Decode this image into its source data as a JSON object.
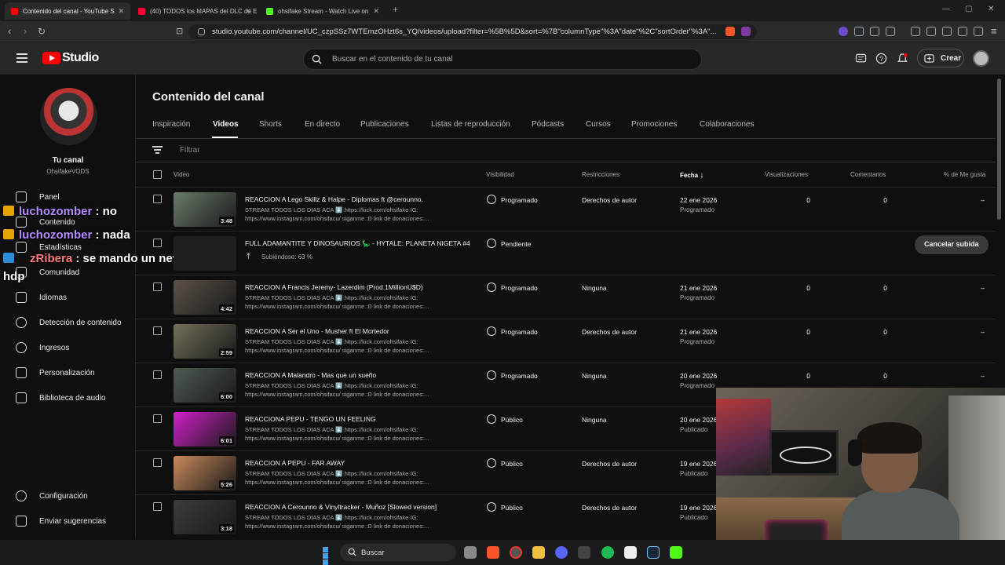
{
  "browser": {
    "tabs": [
      {
        "title": "Contenido del canal - YouTube S",
        "active": true,
        "color": "#ff0000"
      },
      {
        "title": "(40) TODOS los MAPAS del DLC de E",
        "active": false,
        "color": "#ff0033"
      },
      {
        "title": "ohsifake Stream - Watch Live on",
        "active": false,
        "color": "#53fc18"
      }
    ],
    "new_tab": "+",
    "url": "studio.youtube.com/channel/UC_czpSSz7WTEmzOHzt6s_YQ/videos/upload?filter=%5B%5D&sort=%7B\"columnType\"%3A\"date\"%2C\"sortOrder\"%3A\"..."
  },
  "studio": {
    "logo_text": "Studio",
    "search_placeholder": "Buscar en el contenido de tu canal",
    "create_label": "Crear"
  },
  "channel": {
    "title": "Tu canal",
    "handle": "OhsifakeVODS"
  },
  "sidebar": {
    "items": [
      {
        "label": "Panel",
        "icon": "dashboard-icon"
      },
      {
        "label": "Contenido",
        "icon": "content-icon"
      },
      {
        "label": "Estadísticas",
        "icon": "analytics-icon"
      },
      {
        "label": "Comunidad",
        "icon": "community-icon"
      },
      {
        "label": "Idiomas",
        "icon": "languages-icon"
      },
      {
        "label": "Detección de contenido",
        "icon": "content-detection-icon"
      },
      {
        "label": "Ingresos",
        "icon": "earn-icon"
      },
      {
        "label": "Personalización",
        "icon": "customization-icon"
      },
      {
        "label": "Biblioteca de audio",
        "icon": "audio-library-icon"
      }
    ],
    "bottom_items": [
      {
        "label": "Configuración",
        "icon": "settings-icon"
      },
      {
        "label": "Enviar sugerencias",
        "icon": "feedback-icon"
      }
    ]
  },
  "chat_overlay": [
    {
      "user": "luchozomber",
      "message": ": no"
    },
    {
      "user": "luchozomber",
      "message": ": nada"
    },
    {
      "user": "zRibera",
      "message": ": se mando un nevadito el",
      "continuation": "hdp"
    }
  ],
  "main": {
    "title": "Contenido del canal",
    "tabs": [
      "Inspiración",
      "Videos",
      "Shorts",
      "En directo",
      "Publicaciones",
      "Listas de reproducción",
      "Pódcasts",
      "Cursos",
      "Promociones",
      "Colaboraciones"
    ],
    "active_tab": "Videos",
    "filter_label": "Filtrar",
    "columns": {
      "video": "Video",
      "visibility": "Visibilidad",
      "restrictions": "Restricciones",
      "date": "Fecha",
      "views": "Visualizaciones",
      "comments": "Comentarios",
      "likes": "% de Me gusta"
    },
    "cancel_upload": "Cancelar subida",
    "rows": [
      {
        "title": "REACCION A Lego Skillz & Halpe - Diplomas ft @cerounno.",
        "desc1": "STREAM TODOS LOS DIAS ACA ⬇️ https://kick.com/ohsifake IG:",
        "desc2": "https://www.instagram.com/ohsifacu/ siganme :D link de donaciones:...",
        "duration": "3:48",
        "visibility": "Programado",
        "visibility_icon": "clock-icon",
        "restrictions": "Derechos de autor",
        "date": "22 ene 2026",
        "status": "Programado",
        "views": "0",
        "comments": "0",
        "likes": "–",
        "thumb_color": "#6a7b6a"
      },
      {
        "title": "FULL ADAMANTITE Y DINOSAURIOS 🦕 - HYTALE: PLANETA NIGETA #4",
        "progress": "Subiéndose: 63 %",
        "visibility": "Pendiente",
        "visibility_icon": "clock-icon",
        "uploading": true
      },
      {
        "title": "REACCION A Francis Jeremy- Lazerdim (Prod.1MillionU$D)",
        "desc1": "STREAM TODOS LOS DIAS ACA ⬇️ https://kick.com/ohsifake IG:",
        "desc2": "https://www.instagram.com/ohsifacu/ siganme :D link de donaciones:...",
        "duration": "4:42",
        "visibility": "Programado",
        "visibility_icon": "clock-icon",
        "restrictions": "Ninguna",
        "date": "21 ene 2026",
        "status": "Programado",
        "views": "0",
        "comments": "0",
        "likes": "–",
        "thumb_color": "#5b5148"
      },
      {
        "title": "REACCION A Ser el Uno - Musher ft El Mortedor",
        "desc1": "STREAM TODOS LOS DIAS ACA ⬇️ https://kick.com/ohsifake IG:",
        "desc2": "https://www.instagram.com/ohsifacu/ siganme :D link de donaciones:...",
        "duration": "2:59",
        "visibility": "Programado",
        "visibility_icon": "clock-icon",
        "restrictions": "Derechos de autor",
        "date": "21 ene 2026",
        "status": "Programado",
        "views": "0",
        "comments": "0",
        "likes": "–",
        "thumb_color": "#74705a"
      },
      {
        "title": "REACCION A Malandro - Mas que un sueño",
        "desc1": "STREAM TODOS LOS DIAS ACA ⬇️ https://kick.com/ohsifake IG:",
        "desc2": "https://www.instagram.com/ohsifacu/ siganme :D link de donaciones:...",
        "duration": "6:00",
        "visibility": "Programado",
        "visibility_icon": "clock-icon",
        "restrictions": "Ninguna",
        "date": "20 ene 2026",
        "status": "Programado",
        "views": "0",
        "comments": "0",
        "likes": "–",
        "thumb_color": "#4f5a52"
      },
      {
        "title": "REACCIONA PEPU - TENGO UN FEELING",
        "desc1": "STREAM TODOS LOS DIAS ACA ⬇️ https://kick.com/ohsifake IG:",
        "desc2": "https://www.instagram.com/ohsifacu/ siganme :D link de donaciones:...",
        "duration": "6:01",
        "visibility": "Público",
        "visibility_icon": "globe-icon",
        "restrictions": "Ninguna",
        "date": "20 ene 2026",
        "status": "Publicado",
        "views": "",
        "comments": "",
        "likes": "",
        "thumb_color": "#d020c8"
      },
      {
        "title": "REACCION A PEPU - FAR AWAY",
        "desc1": "STREAM TODOS LOS DIAS ACA ⬇️ https://kick.com/ohsifake IG:",
        "desc2": "https://www.instagram.com/ohsifacu/ siganme :D link de donaciones:...",
        "duration": "5:26",
        "visibility": "Público",
        "visibility_icon": "globe-icon",
        "restrictions": "Derechos de autor",
        "date": "19 ene 2026",
        "status": "Publicado",
        "views": "",
        "comments": "",
        "likes": "",
        "thumb_color": "#c98a5a"
      },
      {
        "title": "REACCION A Cerounno & Vinyltracker - Muñoz [Slowed version]",
        "desc1": "STREAM TODOS LOS DIAS ACA ⬇️ https://kick.com/ohsifake IG:",
        "desc2": "https://www.instagram.com/ohsifacu/ siganme :D link de donaciones:...",
        "duration": "3:18",
        "visibility": "Público",
        "visibility_icon": "globe-icon",
        "restrictions": "Derechos de autor",
        "date": "19 ene 2026",
        "status": "Publicado",
        "views": "",
        "comments": "",
        "likes": "",
        "thumb_color": "#3b3b3b"
      }
    ]
  },
  "taskbar": {
    "search_label": "Buscar",
    "apps": [
      "file-explorer-icon",
      "brave-icon",
      "chrome-icon",
      "folder-icon",
      "discord-icon",
      "pen-icon",
      "spotify-icon",
      "capcut-icon",
      "steam-icon",
      "kick-icon"
    ]
  }
}
